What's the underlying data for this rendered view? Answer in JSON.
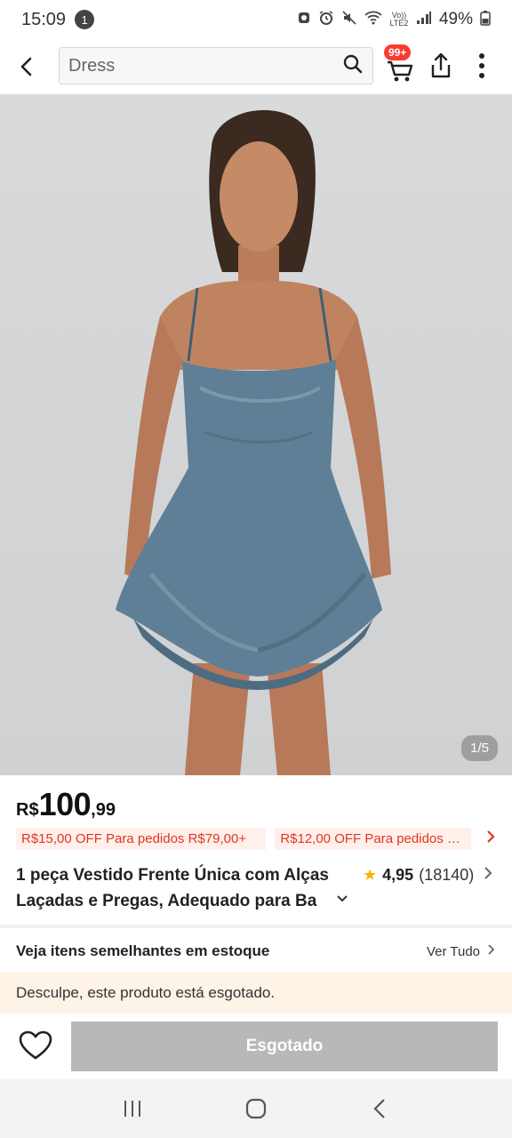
{
  "status_bar": {
    "time": "15:09",
    "notification_count": "1",
    "battery": "49%",
    "icons": [
      "cloud-icon",
      "alarm-icon",
      "mute-icon",
      "wifi-icon",
      "volte-icon",
      "signal-icon",
      "battery-icon"
    ],
    "volte_label": "Vo)) LTE2"
  },
  "header": {
    "search_value": "Dress",
    "cart_badge": "99+",
    "icons": [
      "back-icon",
      "search-icon",
      "cart-icon",
      "share-icon",
      "more-icon"
    ]
  },
  "product": {
    "image_counter": "1/5",
    "price": {
      "currency": "R$",
      "integer": "100",
      "decimal": ",99"
    },
    "coupons": [
      "R$15,00 OFF Para pedidos R$79,00+",
      "R$12,00 OFF Para pedidos R$..."
    ],
    "title": "1 peça Vestido Frente Única com Alças Laçadas e Pregas, Adequado para Ba",
    "rating": {
      "value": "4,95",
      "count": "(18140)"
    }
  },
  "similar": {
    "title": "Veja itens semelhantes em estoque",
    "see_all": "Ver Tudo"
  },
  "notice": {
    "sold_out_text": "Desculpe, este produto está esgotado."
  },
  "bottom_bar": {
    "sold_out_button": "Esgotado"
  },
  "colors": {
    "accent_red": "#fa3b2e",
    "coupon_text": "#e2361f",
    "coupon_bg": "#fff0ec",
    "sold_out_button_bg": "#b8b8b8",
    "notice_bg": "#fdf3e6",
    "star": "#f5b400",
    "dress": "#5e7f95"
  }
}
